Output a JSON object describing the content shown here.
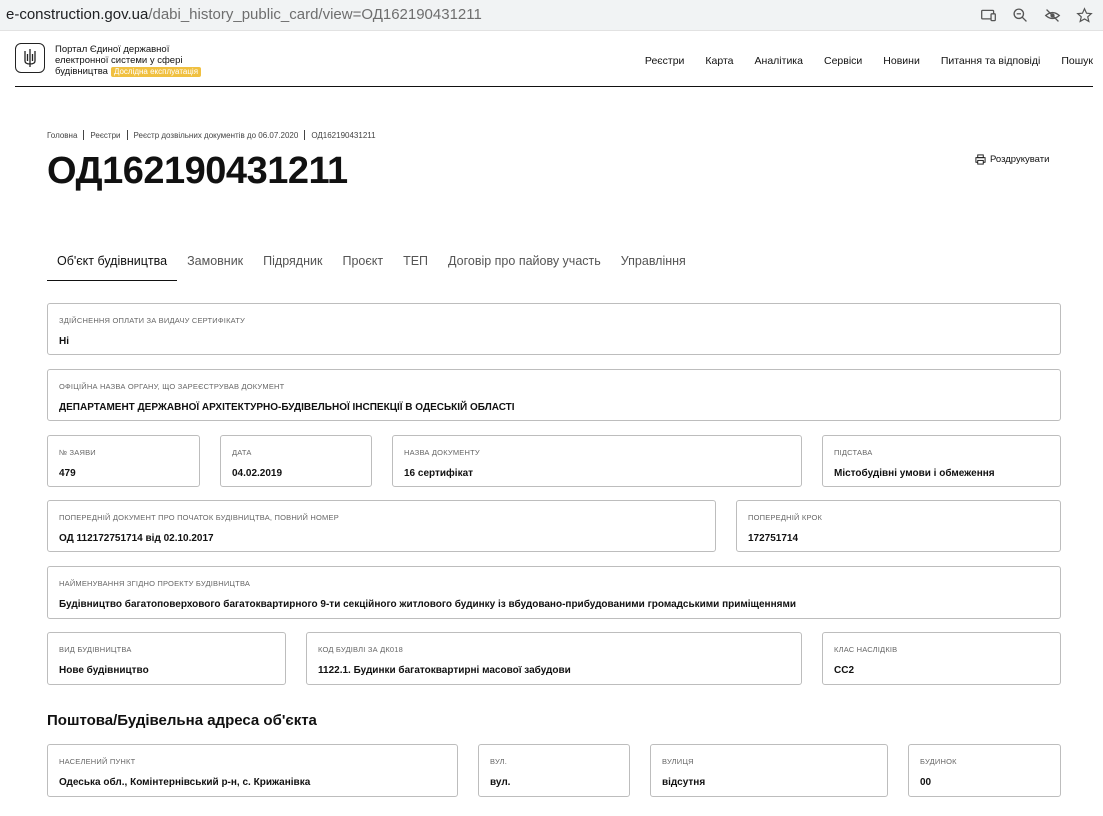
{
  "browser": {
    "url_host": "e-construction.gov.ua",
    "url_path": "/dabi_history_public_card/view=ОД162190431211"
  },
  "header": {
    "portal_line1": "Портал Єдиної державної",
    "portal_line2": "електронної системи у сфері",
    "portal_line3": "будівництва",
    "badge": "Дослідна експлуатація",
    "nav": [
      "Реєстри",
      "Карта",
      "Аналітика",
      "Сервіси",
      "Новини",
      "Питання та відповіді",
      "Пошук"
    ]
  },
  "breadcrumbs": [
    "Головна",
    "Реєстри",
    "Реєстр дозвільних документів до 06.07.2020",
    "ОД162190431211"
  ],
  "page": {
    "title": "ОД162190431211",
    "print_label": "Роздрукувати"
  },
  "tabs": [
    "Об'єкт будівництва",
    "Замовник",
    "Підрядник",
    "Проєкт",
    "ТЕП",
    "Договір про пайову участь",
    "Управління"
  ],
  "fields": {
    "payment": {
      "label": "Здійснення оплати за видачу сертифікату",
      "value": "Ні"
    },
    "authority": {
      "label": "Офіційна назва органу, що зареєстрував документ",
      "value": "ДЕПАРТАМЕНТ ДЕРЖАВНОЇ АРХІТЕКТУРНО-БУДІВЕЛЬНОЇ ІНСПЕКЦІЇ В ОДЕСЬКІЙ ОБЛАСТІ"
    },
    "application_no": {
      "label": "№ заяви",
      "value": "479"
    },
    "date": {
      "label": "Дата",
      "value": "04.02.2019"
    },
    "doc_name": {
      "label": "Назва документу",
      "value": "16 сертифікат"
    },
    "basis": {
      "label": "Підстава",
      "value": "Містобудівні умови і обмеження"
    },
    "prev_doc": {
      "label": "Попередній документ про початок будівництва, повний номер",
      "value": "ОД 112172751714 від 02.10.2017"
    },
    "prev_step": {
      "label": "Попередній крок",
      "value": "172751714"
    },
    "project_name": {
      "label": "Найменування згідно проекту будівництва",
      "value": "Будівництво багатоповерхового багатоквартирного 9-ти секційного житлового будинку із вбудовано-прибудованими громадськими приміщеннями"
    },
    "construction_type": {
      "label": "Вид будівництва",
      "value": "Нове будівництво"
    },
    "building_code": {
      "label": "Код будівлі за ДК018",
      "value": "1122.1. Будинки багатоквартирні масової забудови"
    },
    "consequence_class": {
      "label": "Клас наслідків",
      "value": "СС2"
    }
  },
  "address": {
    "section_title": "Поштова/Будівельна адреса об'єкта",
    "settlement": {
      "label": "Населений пункт",
      "value": "Одеська обл., Комінтернівський р-н, с. Крижанівка"
    },
    "street_type": {
      "label": "Вул.",
      "value": "вул."
    },
    "street": {
      "label": "Вулиця",
      "value": "відсутня"
    },
    "building": {
      "label": "Будинок",
      "value": "00"
    }
  }
}
